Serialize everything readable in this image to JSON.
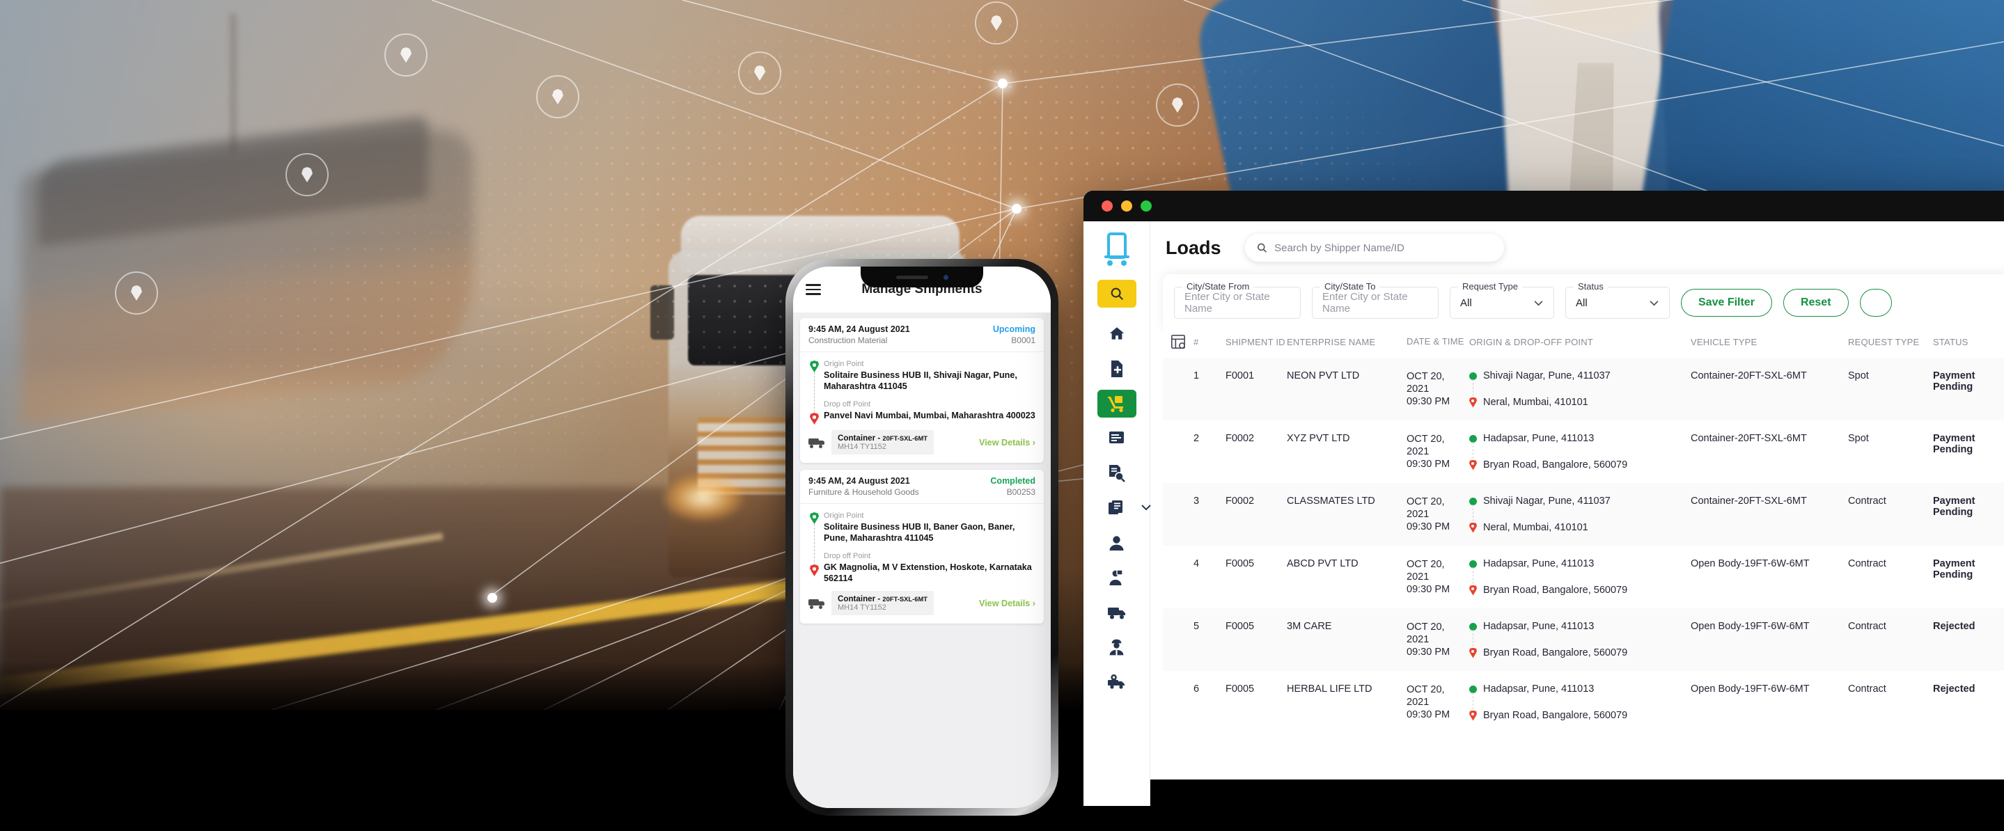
{
  "background": {
    "scene": "logistics hero image: cargo ship, highway truck, businessman in blue suit, dotted world map with connection network lines and location pins"
  },
  "phone": {
    "app_title": "Manage Shipments",
    "menu_icon": "hamburger-icon",
    "cards": [
      {
        "datetime": "9:45 AM, 24 August 2021",
        "status": "Upcoming",
        "status_type": "upcoming",
        "cargo": "Construction Material",
        "booking_id": "B0001",
        "origin_label": "Origin Point",
        "origin_address": "Solitaire Business HUB II, Shivaji Nagar, Pune, Maharashtra 411045",
        "drop_label": "Drop off Point",
        "drop_address": "Panvel Navi Mumbai, Mumbai, Maharashtra 400023",
        "vehicle_type": "Container",
        "vehicle_spec": "20FT-SXL-6MT",
        "vehicle_number": "MH14 TY1152",
        "action": "View Details"
      },
      {
        "datetime": "9:45 AM, 24 August 2021",
        "status": "Completed",
        "status_type": "completed",
        "cargo": "Furniture & Household Goods",
        "booking_id": "B00253",
        "origin_label": "Origin Point",
        "origin_address": "Solitaire Business HUB II, Baner Gaon, Baner, Pune, Maharashtra 411045",
        "drop_label": "Drop off Point",
        "drop_address": "GK Magnolia, M V Extenstion, Hoskote, Karnataka 562114",
        "vehicle_type": "Container",
        "vehicle_spec": "20FT-SXL-6MT",
        "vehicle_number": "MH14 TY1152",
        "action": "View Details"
      }
    ]
  },
  "desktop": {
    "titlebar": {
      "close": "close-traffic-light",
      "minimize": "minimize-traffic-light",
      "maximize": "maximize-traffic-light"
    },
    "sidebar": {
      "logo": "tablet-on-wheels-logo",
      "search_icon": "search-icon",
      "items": [
        {
          "icon": "home-icon",
          "name": "home",
          "active": false
        },
        {
          "icon": "add-document-icon",
          "name": "create-booking",
          "active": false
        },
        {
          "icon": "hand-truck-icon",
          "name": "loads",
          "active": true
        },
        {
          "icon": "document-lines-icon",
          "name": "orders",
          "active": false
        },
        {
          "icon": "document-search-icon",
          "name": "track-shipment",
          "active": false
        },
        {
          "icon": "invoice-stack-icon",
          "name": "invoices",
          "active": false,
          "chevron": "chevron-down-icon"
        },
        {
          "icon": "user-icon",
          "name": "users",
          "active": false
        },
        {
          "icon": "person-package-icon",
          "name": "shippers",
          "active": false
        },
        {
          "icon": "truck-icon",
          "name": "vehicles",
          "active": false
        },
        {
          "icon": "driver-icon",
          "name": "drivers",
          "active": false
        },
        {
          "icon": "truck-location-icon",
          "name": "tracking",
          "active": false
        }
      ]
    },
    "header": {
      "title": "Loads",
      "search_placeholder": "Search by Shipper Name/ID",
      "search_value": "",
      "search_icon": "search-icon"
    },
    "filters": [
      {
        "label": "City/State From",
        "type": "input",
        "placeholder": "Enter City or State Name",
        "value": ""
      },
      {
        "label": "City/State To",
        "type": "input",
        "placeholder": "Enter City or State Name",
        "value": ""
      },
      {
        "label": "Request Type",
        "type": "select",
        "value": "All",
        "chevron": "chevron-down-icon"
      },
      {
        "label": "Status",
        "type": "select",
        "value": "All",
        "chevron": "chevron-down-icon"
      }
    ],
    "filter_buttons": [
      {
        "label": "Save Filter",
        "name": "save-filter-button"
      },
      {
        "label": "Reset",
        "name": "reset-button"
      },
      {
        "label": "",
        "name": "overflow-button"
      }
    ],
    "table": {
      "grid_icon": "table-settings-icon",
      "columns": [
        "#",
        "SHIPMENT ID",
        "ENTERPRISE NAME",
        "DATE & TIME",
        "ORIGIN & DROP-OFF POINT",
        "VEHICLE TYPE",
        "REQUEST TYPE",
        "STATUS"
      ],
      "rows": [
        {
          "num": "1",
          "shipment_id": "F0001",
          "enterprise": "NEON PVT LTD",
          "date": "OCT 20, 2021",
          "time": "09:30 PM",
          "origin": "Shivaji Nagar, Pune, 411037",
          "drop": "Neral, Mumbai, 410101",
          "vehicle": "Container-20FT-SXL-6MT",
          "request_type": "Spot",
          "status": "Payment Pending",
          "status_kind": "pending"
        },
        {
          "num": "2",
          "shipment_id": "F0002",
          "enterprise": "XYZ PVT LTD",
          "date": "OCT 20, 2021",
          "time": "09:30 PM",
          "origin": "Hadapsar, Pune, 411013",
          "drop": "Bryan Road, Bangalore, 560079",
          "vehicle": "Container-20FT-SXL-6MT",
          "request_type": "Spot",
          "status": "Payment Pending",
          "status_kind": "pending"
        },
        {
          "num": "3",
          "shipment_id": "F0002",
          "enterprise": "CLASSMATES LTD",
          "date": "OCT 20, 2021",
          "time": "09:30 PM",
          "origin": "Shivaji Nagar, Pune, 411037",
          "drop": "Neral, Mumbai, 410101",
          "vehicle": "Container-20FT-SXL-6MT",
          "request_type": "Contract",
          "status": "Payment Pending",
          "status_kind": "pending"
        },
        {
          "num": "4",
          "shipment_id": "F0005",
          "enterprise": "ABCD PVT LTD",
          "date": "OCT 20, 2021",
          "time": "09:30 PM",
          "origin": "Hadapsar, Pune, 411013",
          "drop": "Bryan Road, Bangalore, 560079",
          "vehicle": "Open Body-19FT-6W-6MT",
          "request_type": "Contract",
          "status": "Payment Pending",
          "status_kind": "pending"
        },
        {
          "num": "5",
          "shipment_id": "F0005",
          "enterprise": "3M CARE",
          "date": "OCT 20, 2021",
          "time": "09:30 PM",
          "origin": "Hadapsar, Pune, 411013",
          "drop": "Bryan Road, Bangalore, 560079",
          "vehicle": "Open Body-19FT-6W-6MT",
          "request_type": "Contract",
          "status": "Rejected",
          "status_kind": "rejected"
        },
        {
          "num": "6",
          "shipment_id": "F0005",
          "enterprise": "HERBAL LIFE LTD",
          "date": "OCT 20, 2021",
          "time": "09:30 PM",
          "origin": "Hadapsar, Pune, 411013",
          "drop": "Bryan Road, Bangalore, 560079",
          "vehicle": "Open Body-19FT-6W-6MT",
          "request_type": "Contract",
          "status": "Rejected",
          "status_kind": "rejected"
        }
      ]
    }
  },
  "colors": {
    "brand_green": "#159041",
    "brand_yellow": "#f5cb14",
    "brand_blue": "#35b8e8",
    "navy": "#26354f",
    "status_red": "#e8174b",
    "origin_green": "#17a24a",
    "drop_red": "#e8432e",
    "link_green": "#8bc34a",
    "upcoming_blue": "#24a0ed",
    "completed_green": "#18a558"
  }
}
